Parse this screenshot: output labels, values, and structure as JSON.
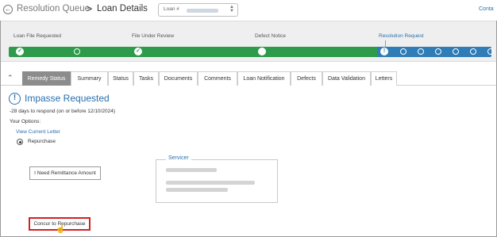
{
  "header": {
    "back_icon": "back-arrow-icon",
    "breadcrumb_parent": "Resolution Queue",
    "breadcrumb_separator": ">",
    "page_title": "Loan Details",
    "loan_label": "Loan #",
    "contact_text": "Conta"
  },
  "progress": {
    "stages": [
      {
        "label": "Loan File Requested",
        "state": "complete"
      },
      {
        "label": "File Under Review",
        "state": "complete"
      },
      {
        "label": "Defect Notice",
        "state": "complete"
      },
      {
        "label": "Resolution Request",
        "state": "current"
      }
    ],
    "colors": {
      "complete": "#2e9a4c",
      "pending": "#2f7cb6"
    }
  },
  "tabs": {
    "collapse_icon": "chevron-up-icon",
    "items": [
      {
        "label": "Remedy Status",
        "active": true
      },
      {
        "label": "Summary",
        "active": false
      },
      {
        "label": "Status",
        "active": false
      },
      {
        "label": "Tasks",
        "active": false
      },
      {
        "label": "Documents",
        "active": false
      },
      {
        "label": "Comments",
        "active": false
      },
      {
        "label": "Loan Notification",
        "active": false
      },
      {
        "label": "Defects",
        "active": false
      },
      {
        "label": "Data Validation",
        "active": false
      },
      {
        "label": "Letters",
        "active": false
      }
    ]
  },
  "remedy": {
    "status_icon": "exclamation-circle-icon",
    "status_title": "Impasse Requested",
    "respond_text": "-28 days to respond (on or before 12/10/2024)",
    "options_label": "Your Options:",
    "view_letter_link": "View Current Letter",
    "option_repurchase": "Repurchase",
    "remittance_button": "I Need Remittance Amount",
    "servicer_label": "Servicer",
    "concur_button": "Concur to Repurchase"
  },
  "accent_color": "#2a6fae"
}
